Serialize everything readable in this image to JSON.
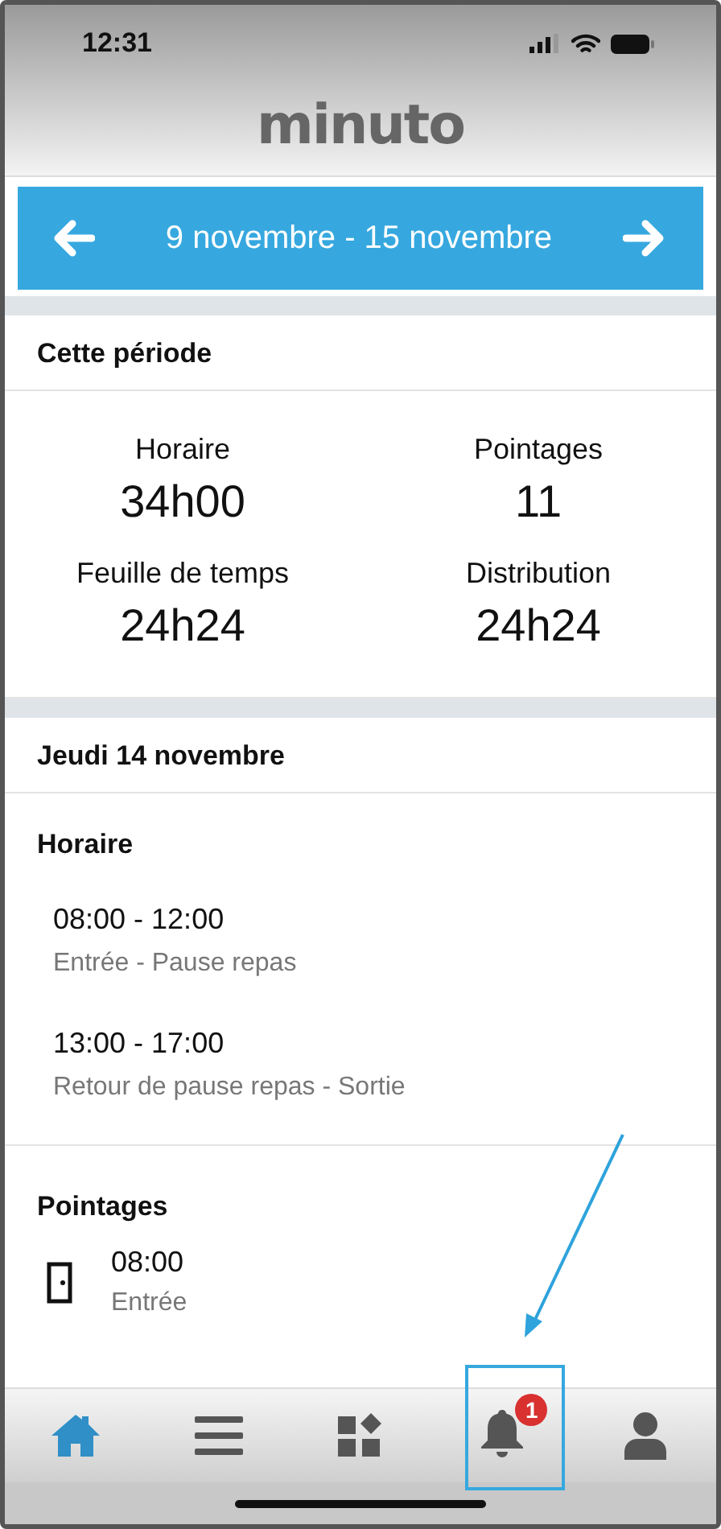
{
  "status_bar": {
    "time": "12:31"
  },
  "logo": "minuto",
  "period_nav": {
    "label": "9 novembre - 15 novembre"
  },
  "summary": {
    "title": "Cette période",
    "stats": [
      {
        "label": "Horaire",
        "value": "34h00"
      },
      {
        "label": "Pointages",
        "value": "11"
      },
      {
        "label": "Feuille de temps",
        "value": "24h24"
      },
      {
        "label": "Distribution",
        "value": "24h24"
      }
    ]
  },
  "day": {
    "title": "Jeudi 14 novembre"
  },
  "schedule": {
    "title": "Horaire",
    "items": [
      {
        "time": "08:00 - 12:00",
        "detail": "Entrée - Pause repas"
      },
      {
        "time": "13:00 - 17:00",
        "detail": "Retour de pause repas - Sortie"
      }
    ]
  },
  "punches": {
    "title": "Pointages",
    "items": [
      {
        "time": "08:00",
        "detail": "Entrée"
      }
    ]
  },
  "tab_bar": [
    {
      "kind": "home",
      "selected": true
    },
    {
      "kind": "menu",
      "selected": false
    },
    {
      "kind": "apps",
      "selected": false
    },
    {
      "kind": "bell",
      "selected": false,
      "badge": "1"
    },
    {
      "kind": "user",
      "selected": false
    }
  ]
}
